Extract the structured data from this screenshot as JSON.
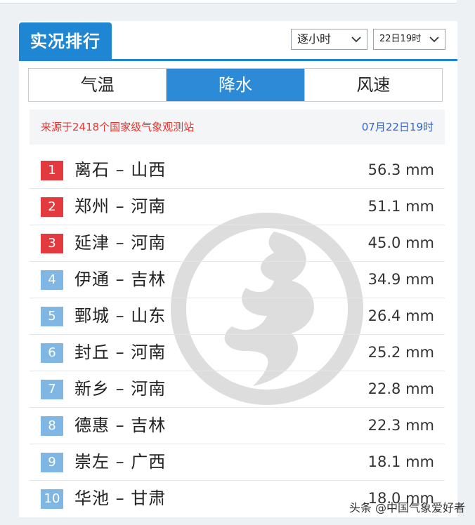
{
  "header": {
    "title": "实况排行",
    "interval_select": "逐小时",
    "time_select": "22日19时"
  },
  "tabs": [
    {
      "label": "气温",
      "active": false
    },
    {
      "label": "降水",
      "active": true
    },
    {
      "label": "风速",
      "active": false
    }
  ],
  "source": {
    "text": "来源于2418个国家级气象观测站",
    "time": "07月22日19时"
  },
  "rankings": [
    {
      "rank": "1",
      "station": "离石 – 山西",
      "value": "56.3 mm"
    },
    {
      "rank": "2",
      "station": "郑州 – 河南",
      "value": "51.1 mm"
    },
    {
      "rank": "3",
      "station": "延津 – 河南",
      "value": "45.0 mm"
    },
    {
      "rank": "4",
      "station": "伊通 – 吉林",
      "value": "34.9 mm"
    },
    {
      "rank": "5",
      "station": "鄄城 – 山东",
      "value": "26.4 mm"
    },
    {
      "rank": "6",
      "station": "封丘 – 河南",
      "value": "25.2 mm"
    },
    {
      "rank": "7",
      "station": "新乡 – 河南",
      "value": "22.8 mm"
    },
    {
      "rank": "8",
      "station": "德惠 – 吉林",
      "value": "22.3 mm"
    },
    {
      "rank": "9",
      "station": "崇左 – 广西",
      "value": "18.1 mm"
    },
    {
      "rank": "10",
      "station": "华池 – 甘肃",
      "value": "18.0 mm"
    }
  ],
  "footer": {
    "credit": "头条 @中国气象爱好者"
  },
  "colors": {
    "accent": "#1f86d3",
    "top_rank": "#e23a3e",
    "other_rank": "#7fb6e4",
    "source_text": "#e8332a",
    "source_time": "#2e64d6"
  }
}
